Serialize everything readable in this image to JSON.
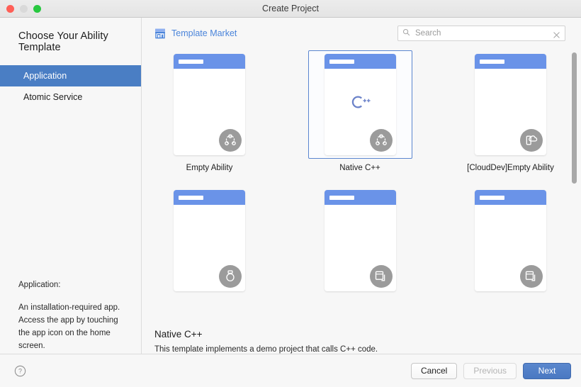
{
  "window": {
    "title": "Create Project",
    "traffic_lights": [
      "close-button",
      "minimize-button",
      "maximize-button"
    ]
  },
  "sidebar": {
    "heading": "Choose Your Ability Template",
    "items": [
      {
        "label": "Application",
        "selected": true
      },
      {
        "label": "Atomic Service",
        "selected": false
      }
    ],
    "description": {
      "title": "Application:",
      "body": "An installation-required app. Access the app by touching the app icon on the home screen."
    }
  },
  "toolbar": {
    "market_label": "Template Market",
    "market_icon": "shop-icon",
    "search": {
      "placeholder": "Search",
      "value": "",
      "search_icon": "search-icon",
      "clear_icon": "close-icon"
    }
  },
  "templates": [
    {
      "label": "Empty Ability",
      "badge": "ability-icon",
      "selected": false,
      "center_logo": "none"
    },
    {
      "label": "Native C++",
      "badge": "ability-icon",
      "selected": true,
      "center_logo": "cpp-logo"
    },
    {
      "label": "[CloudDev]Empty Ability",
      "badge": "clouddev-icon",
      "selected": false,
      "center_logo": "none"
    },
    {
      "label": "",
      "badge": "wearable-icon",
      "selected": false,
      "center_logo": "none"
    },
    {
      "label": "",
      "badge": "multidevice-icon",
      "selected": false,
      "center_logo": "none"
    },
    {
      "label": "",
      "badge": "multidevice-icon",
      "selected": false,
      "center_logo": "none"
    }
  ],
  "detail": {
    "title": "Native C++",
    "description": "This template implements a demo project that calls C++ code."
  },
  "footer": {
    "help_icon": "help-icon",
    "cancel_label": "Cancel",
    "previous_label": "Previous",
    "next_label": "Next"
  },
  "colors": {
    "accent_blue": "#4a7ec4",
    "link_blue": "#4a84da",
    "thumb_header_blue": "#6a93e8",
    "badge_gray": "#9b9b9b",
    "selected_border": "#5b86cf",
    "cpp_logo": "#6b82c9",
    "window_bg": "#f7f7f7"
  }
}
